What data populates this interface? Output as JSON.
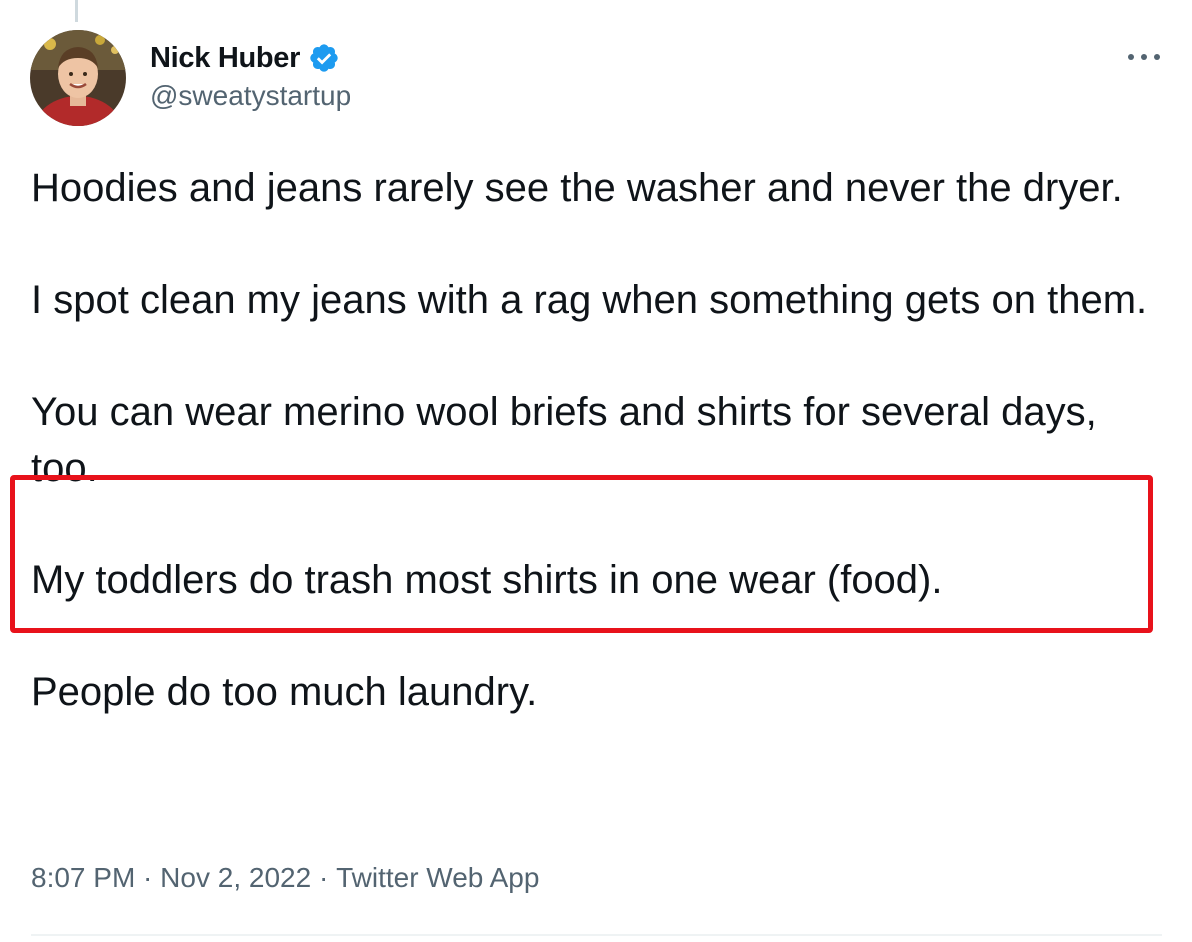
{
  "author": {
    "display_name": "Nick Huber",
    "handle": "@sweatystartup",
    "verified": true
  },
  "tweet": {
    "paragraphs": [
      "Hoodies and jeans rarely see the washer and never the dryer.",
      "I spot clean my jeans with a rag when something gets on them.",
      "You can wear merino wool briefs and shirts for several days, too.",
      "My toddlers do trash most shirts in one wear (food).",
      "People do too much laundry."
    ],
    "highlighted_paragraph_index": 2
  },
  "meta": {
    "time": "8:07 PM",
    "separator": " · ",
    "date": "Nov 2, 2022",
    "source": "Twitter Web App"
  },
  "icons": {
    "verified": "verified-badge-icon",
    "more": "more-options-icon"
  },
  "colors": {
    "text": "#0f1419",
    "secondary_text": "#536471",
    "verified_blue": "#1d9bf0",
    "highlight_red": "#e8121b"
  }
}
